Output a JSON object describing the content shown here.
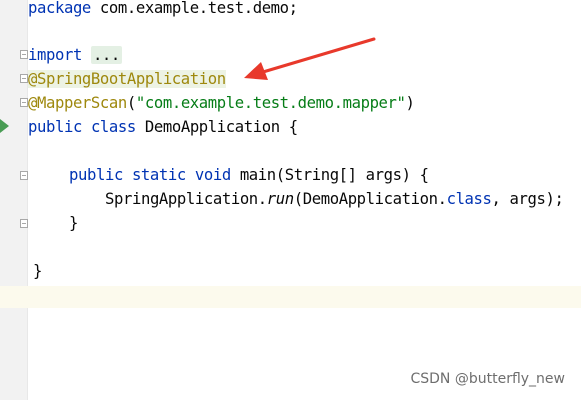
{
  "editor": {
    "package_kw": "package",
    "package_name": " com.example.test.demo;",
    "import_kw": "import",
    "import_dots": "...",
    "annotation_springboot": "@SpringBootApplication",
    "annotation_mapperscan": "@MapperScan",
    "paren_open": "(",
    "mapper_package": "\"com.example.test.demo.mapper\"",
    "paren_close": ")",
    "public_kw": "public",
    "class_kw": "class",
    "class_name": " DemoApplication {",
    "static_kw": "static",
    "void_kw": "void",
    "main_signature": " main(String[] args) {",
    "spring_app": "SpringApplication.",
    "run_method": "run",
    "run_args_open": "(DemoApplication.",
    "class_literal": "class",
    "run_args_close": ", args);",
    "method_close": "}",
    "class_close": "}"
  },
  "watermark": "CSDN @butterfly_new",
  "colors": {
    "keyword": "#0033b3",
    "annotation": "#9e880d",
    "string": "#067d17",
    "arrow": "#e8392b"
  }
}
